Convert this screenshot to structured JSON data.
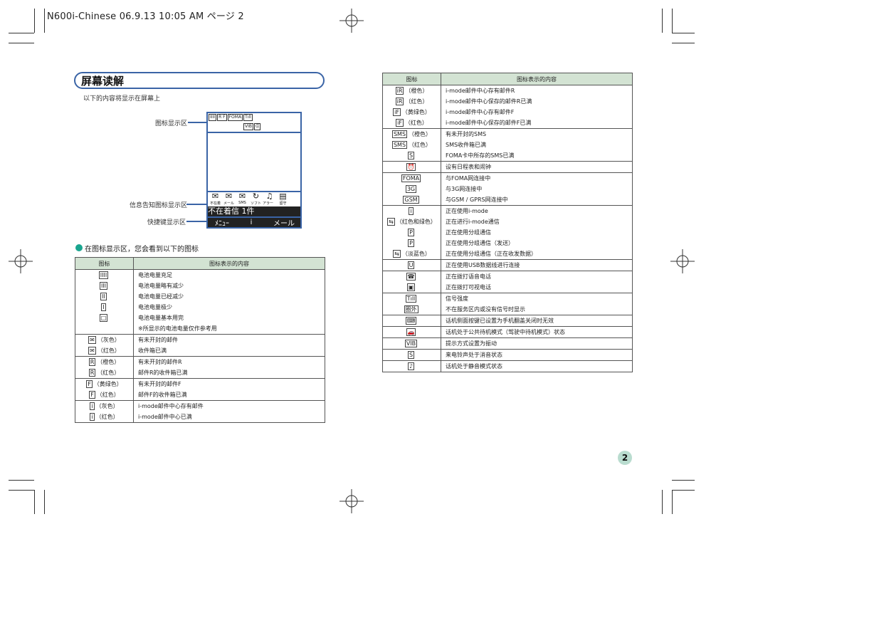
{
  "header": {
    "print_slug": "N600i-Chinese  06.9.13 10:05 AM  ページ 2"
  },
  "section": {
    "title": "屏幕读解",
    "intro": "以下的内容将显示在屏幕上"
  },
  "callouts": {
    "icon_area": "图标显示区",
    "info_area": "信息告知图标显示区",
    "shortcut_area": "快捷键显示区"
  },
  "phone": {
    "status_icons": [
      "IIII",
      "R F",
      "FOMA",
      "Tıll"
    ],
    "status_icons_row2": [
      "VIB",
      "ᗧ"
    ],
    "info_icons": [
      {
        "sym": "✉",
        "label": "不在着"
      },
      {
        "sym": "✉",
        "label": "メール"
      },
      {
        "sym": "✉",
        "label": "SMS"
      },
      {
        "sym": "↻",
        "label": "ソフト"
      },
      {
        "sym": "♫",
        "label": "アラーム"
      },
      {
        "sym": "▤",
        "label": "留守"
      }
    ],
    "unread_text": "不在着信  1件",
    "soft_left": "ﾒﾆｭｰ",
    "soft_center": "i",
    "soft_right": "メール"
  },
  "bullet": "在图标显示区，您会看到以下的图标",
  "table_left": {
    "col_icon": "图标",
    "col_desc": "图标表示的内容",
    "rows": [
      {
        "icon": "IIII",
        "note": "",
        "desc": "电池电量充足",
        "start": true
      },
      {
        "icon": "III",
        "note": "",
        "desc": "电池电量略有减少"
      },
      {
        "icon": "II",
        "note": "",
        "desc": "电池电量已经减少"
      },
      {
        "icon": "I",
        "note": "",
        "desc": "电池电量极少"
      },
      {
        "icon": "□",
        "note": "",
        "desc": "电池电量基本用完"
      },
      {
        "icon": "",
        "note": "",
        "desc": "※所显示的电池电量仅作参考用"
      },
      {
        "icon": "✉",
        "note": "（灰色）",
        "desc": "有未开封的邮件",
        "start": true
      },
      {
        "icon": "✉",
        "note": "（红色）",
        "desc": "收件箱已满"
      },
      {
        "icon": "R",
        "note": "（橙色）",
        "desc": "有未开封的邮件R",
        "start": true
      },
      {
        "icon": "R",
        "note": "（红色）",
        "desc": "邮件R的收件箱已满"
      },
      {
        "icon": "F",
        "note": "（黄绿色）",
        "desc": "有未开封的邮件F",
        "start": true
      },
      {
        "icon": "F",
        "note": "（红色）",
        "desc": "邮件F的收件箱已满"
      },
      {
        "icon": "i",
        "note": "（灰色）",
        "desc": "i-mode邮件中心存有邮件",
        "start": true
      },
      {
        "icon": "i",
        "note": "（红色）",
        "desc": "i-mode邮件中心已满"
      }
    ]
  },
  "table_right": {
    "col_icon": "图标",
    "col_desc": "图标表示的内容",
    "rows": [
      {
        "icon": "iR",
        "note": "（橙色）",
        "desc": "i-mode邮件中心存有邮件R",
        "start": true
      },
      {
        "icon": "iR",
        "note": "（红色）",
        "desc": "i-mode邮件中心保存的邮件R已满"
      },
      {
        "icon": "iF",
        "note": "（黄绿色）",
        "desc": "i-mode邮件中心存有邮件F"
      },
      {
        "icon": "iF",
        "note": "（红色）",
        "desc": "i-mode邮件中心保存的邮件F已满"
      },
      {
        "icon": "SMS",
        "note": "（橙色）",
        "desc": "有未开封的SMS",
        "start": true
      },
      {
        "icon": "SMS",
        "note": "（红色）",
        "desc": "SMS收件箱已满"
      },
      {
        "icon": "S",
        "note": "",
        "desc": "FOMA卡中所存的SMS已满"
      },
      {
        "icon": "⏰",
        "note": "",
        "desc": "设有日程表和闹钟",
        "start": true
      },
      {
        "icon": "FOMA",
        "note": "",
        "desc": "与FOMA网连接中",
        "start": true
      },
      {
        "icon": "3G",
        "note": "",
        "desc": "与3G网连接中"
      },
      {
        "icon": "GSM",
        "note": "",
        "desc": "与GSM / GPRS网连接中"
      },
      {
        "icon": "i",
        "note": "",
        "desc": "正在使用i-mode",
        "start": true
      },
      {
        "icon": "⇆",
        "note": "（红色和绿色）",
        "desc": "正在进行i-mode通信"
      },
      {
        "icon": "P",
        "note": "",
        "desc": "正在使用分组通信"
      },
      {
        "icon": "P",
        "note": "",
        "desc": "正在使用分组通信（发送）"
      },
      {
        "icon": "⇆",
        "note": "（淡蓝色）",
        "desc": "正在使用分组通信（正在收发数据）"
      },
      {
        "icon": "U",
        "note": "",
        "desc": "正在使用USB数据线进行连接",
        "start": true
      },
      {
        "icon": "☎",
        "note": "",
        "desc": "正在拨打语音电话",
        "start": true
      },
      {
        "icon": "▣",
        "note": "",
        "desc": "正在拨打可视电话"
      },
      {
        "icon": "Tıll",
        "note": "",
        "desc": "信号强度",
        "start": true
      },
      {
        "icon": "圈外",
        "note": "",
        "desc": "不在服务区内或没有信号时显示"
      },
      {
        "icon": "⌨",
        "note": "",
        "desc": "话机侧面按键已设置为手机翻盖关闭时无效",
        "start": true
      },
      {
        "icon": "🚗",
        "note": "",
        "desc": "话机处于公共待机模式（驾驶中待机模式）状态",
        "start": true
      },
      {
        "icon": "VIB",
        "note": "",
        "desc": "提示方式设置为振动",
        "start": true
      },
      {
        "icon": "S",
        "note": "",
        "desc": "来电铃声处于消音状态",
        "start": true
      },
      {
        "icon": "♪",
        "note": "",
        "desc": "话机处于静音模式状态",
        "start": true
      }
    ]
  },
  "page_number": "2"
}
